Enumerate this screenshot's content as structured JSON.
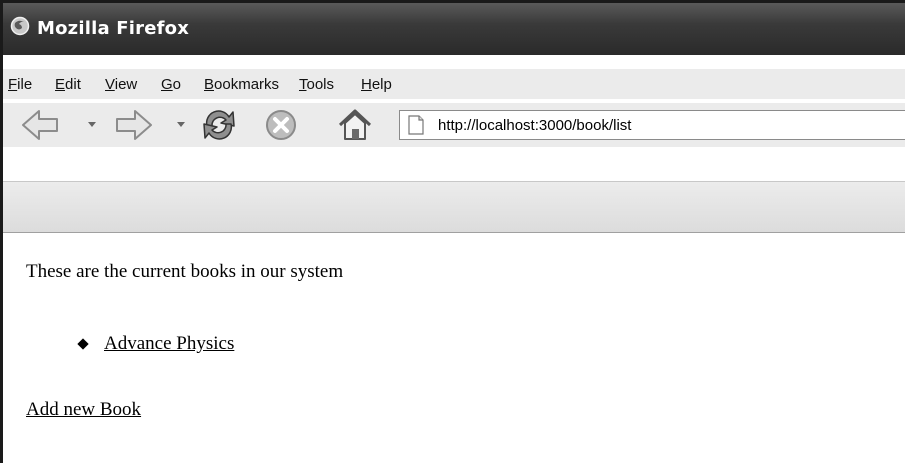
{
  "window": {
    "title": "Mozilla Firefox",
    "icon": "firefox-icon"
  },
  "menu": [
    {
      "label": "File",
      "mnemonic": "F"
    },
    {
      "label": "Edit",
      "mnemonic": "E"
    },
    {
      "label": "View",
      "mnemonic": "V"
    },
    {
      "label": "Go",
      "mnemonic": "G"
    },
    {
      "label": "Bookmarks",
      "mnemonic": "B"
    },
    {
      "label": "Tools",
      "mnemonic": "T"
    },
    {
      "label": "Help",
      "mnemonic": "H"
    }
  ],
  "toolbar": {
    "buttons": [
      "back-icon",
      "forward-icon",
      "reload-icon",
      "stop-icon",
      "home-icon"
    ],
    "url": "http://localhost:3000/book/list",
    "page_icon": "page-icon"
  },
  "content": {
    "intro": "These are the current books in our system",
    "books": [
      "Advance Physics"
    ],
    "add_link": "Add new Book"
  }
}
